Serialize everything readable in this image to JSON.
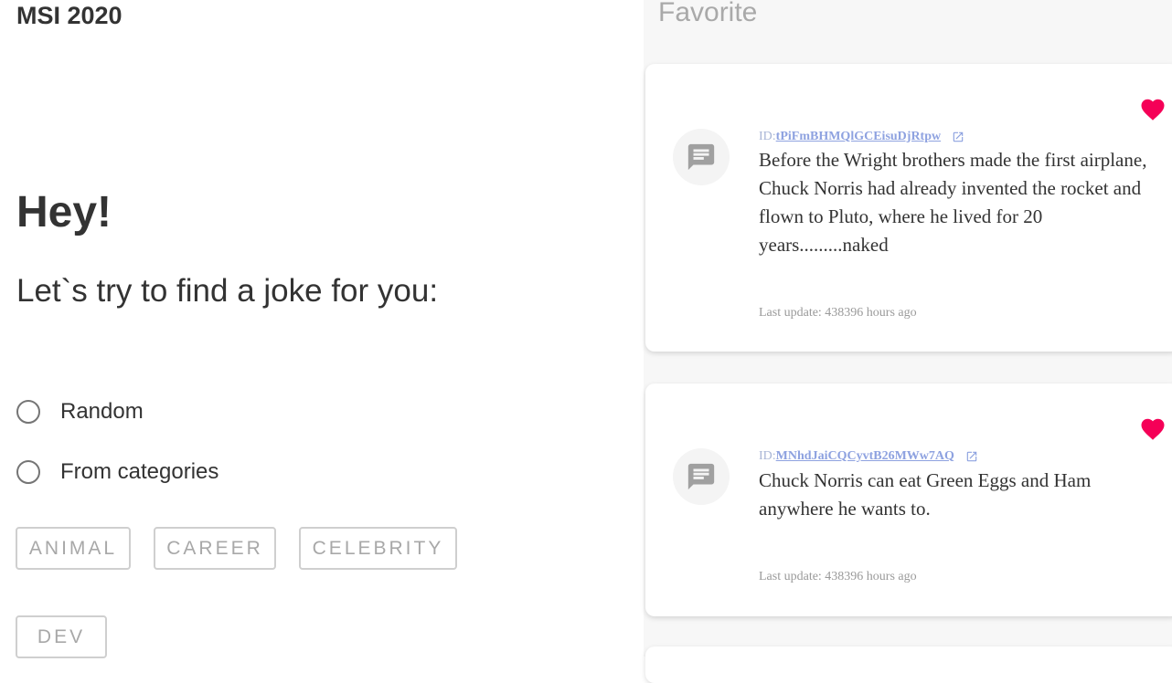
{
  "app": {
    "brand": "MSI 2020"
  },
  "main": {
    "greeting": "Hey!",
    "subtitle": "Let`s try to find a joke for you:",
    "options": [
      {
        "label": "Random",
        "selected": false
      },
      {
        "label": "From categories",
        "selected": false
      }
    ],
    "categories": [
      "ANIMAL",
      "CAREER",
      "CELEBRITY",
      "DEV"
    ]
  },
  "favorites": {
    "title": "Favorite",
    "heart_color": "#f50057",
    "items": [
      {
        "id_prefix": "ID:",
        "id": "tPiFmBHMQlGCEisuDjRtpw",
        "text": "Before the Wright brothers made the first airplane, Chuck Norris had already invented the rocket and flown to Pluto, where he lived for 20 years.........naked",
        "updated": "Last update: 438396 hours ago",
        "favorite": true
      },
      {
        "id_prefix": "ID:",
        "id": "MNhdJaiCQCyvtB26MWw7AQ",
        "text": "Chuck Norris can eat Green Eggs and Ham anywhere he wants to.",
        "updated": "Last update: 438396 hours ago",
        "favorite": true
      }
    ]
  }
}
